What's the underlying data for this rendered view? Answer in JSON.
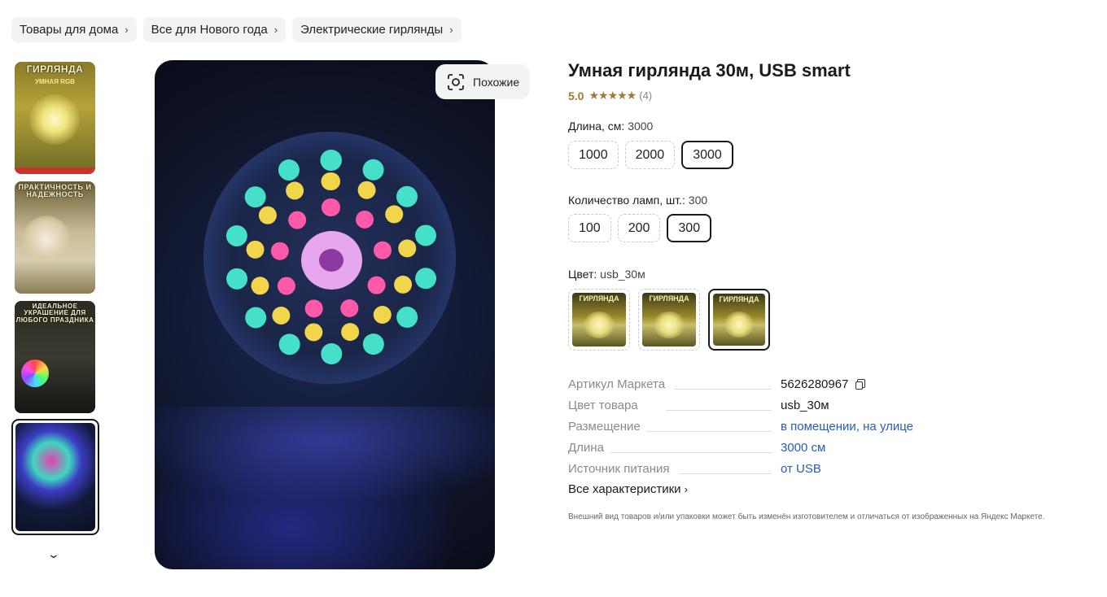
{
  "breadcrumbs": [
    {
      "label": "Товары для дома"
    },
    {
      "label": "Все для Нового года"
    },
    {
      "label": "Электрические гирлянды"
    }
  ],
  "thumbnails": [
    {
      "title": "ГИРЛЯНДА",
      "subtitle": "УМНАЯ RGB"
    },
    {
      "title": "ПРАКТИЧНОСТЬ И НАДЕЖНОСТЬ",
      "subtitle": ""
    },
    {
      "title": "ИДЕАЛЬНОЕ УКРАШЕНИЕ ДЛЯ ЛЮБОГО ПРАЗДНИКА",
      "subtitle": ""
    },
    {
      "title": "",
      "subtitle": ""
    }
  ],
  "similar_button": {
    "label": "Похожие"
  },
  "product": {
    "title": "Умная гирлянда 30м, USB smart",
    "rating": "5.0",
    "stars": "★★★★★",
    "reviews": "(4)"
  },
  "length": {
    "label": "Длина, см:",
    "value": "3000",
    "options": [
      "1000",
      "2000",
      "3000"
    ],
    "selected": "3000"
  },
  "lamps": {
    "label": "Количество ламп, шт.:",
    "value": "300",
    "options": [
      "100",
      "200",
      "300"
    ],
    "selected": "300"
  },
  "color": {
    "label": "Цвет:",
    "value": "usb_30м",
    "swatch_title": "ГИРЛЯНДА"
  },
  "specs": [
    {
      "key": "Артикул Маркета",
      "value": "5626280967"
    },
    {
      "key": "Цвет товара",
      "value": "usb_30м"
    },
    {
      "key": "Размещение",
      "value": "в помещении, на улице"
    },
    {
      "key": "Длина",
      "value": "3000 см"
    },
    {
      "key": "Источник питания",
      "value": "от USB"
    }
  ],
  "all_specs_label": "Все характеристики",
  "disclaimer": "Внешний вид товаров и/или упаковки может быть изменён изготовителем и отличаться от изображенных на Яндекс Маркете.",
  "colors": {
    "link": "#2a5bb8",
    "rating": "#a07a2e",
    "selected_border": "#1a1a1a"
  }
}
